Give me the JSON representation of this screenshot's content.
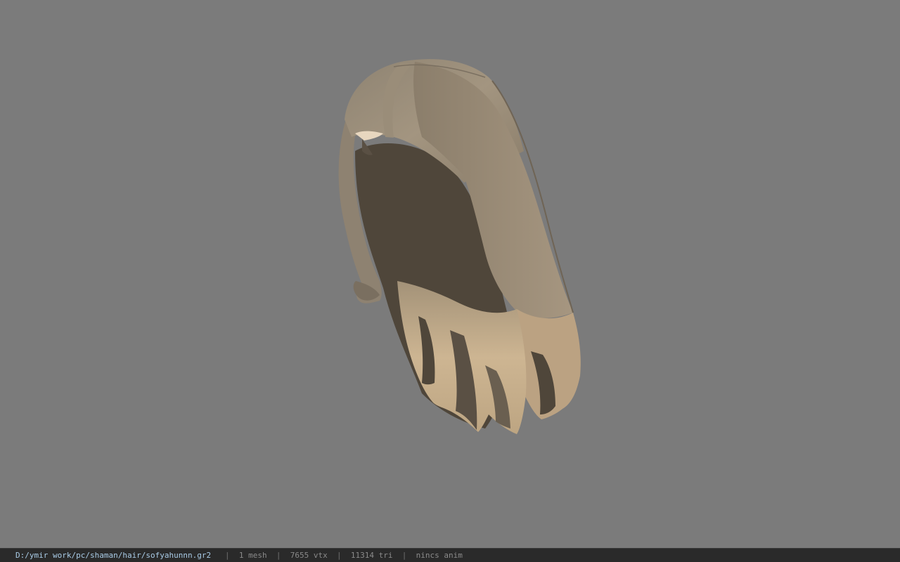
{
  "viewport": {
    "background_color": "#7b7b7b",
    "model_colors": {
      "light": "#c8b08c",
      "mid": "#9c8c76",
      "dark": "#4f463a"
    }
  },
  "statusbar": {
    "file_path": "D:/ymir work/pc/shaman/hair/sofyahunnn.gr2",
    "separator": "|",
    "mesh_count": "1 mesh",
    "vertex_count": "7655 vtx",
    "triangle_count": "11314 tri",
    "anim_status": "nincs anim"
  }
}
